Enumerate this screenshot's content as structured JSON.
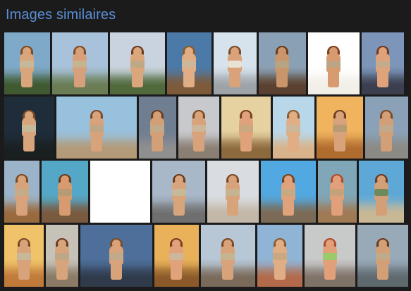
{
  "page": {
    "title": "Images similaires",
    "accent_color": "#5b8fd6",
    "background_color": "#1b1b1b"
  },
  "rows": [
    [
      {
        "sky": "#7fa9c8",
        "ground": "#3f5a30",
        "skin": "#d9a57a",
        "hair": "#7a4a24",
        "outfit": "#c8b89a"
      },
      {
        "sky": "#a7c2da",
        "ground": "#6a7d55",
        "skin": "#d7a07a",
        "hair": "#7a4a24",
        "outfit": "#c6b491"
      },
      {
        "sky": "#c9d3df",
        "ground": "#516a3b",
        "skin": "#dca67d",
        "hair": "#6b3a1e",
        "outfit": "#bfa886"
      },
      {
        "sky": "#4c7aa8",
        "ground": "#7d5a3a",
        "skin": "#e1ad84",
        "hair": "#8a5a2b",
        "outfit": "#cdb79a"
      },
      {
        "sky": "#d6e2ec",
        "ground": "#9ea3a8",
        "skin": "#d8a27a",
        "hair": "#7a4a24",
        "outfit": "#e8e2d4"
      },
      {
        "sky": "#8aa1b5",
        "ground": "#5b4230",
        "skin": "#c9956b",
        "hair": "#6b3a1e",
        "outfit": "#b7a481"
      },
      {
        "sky": "#ffffff",
        "ground": "#f2efe8",
        "skin": "#d89a6f",
        "hair": "#7a3e1e",
        "outfit": "#bca586"
      },
      {
        "sky": "#7c95b8",
        "ground": "#3b3f4f",
        "skin": "#e0a27b",
        "hair": "#6f3a20",
        "outfit": "#c5aa8b"
      }
    ],
    [
      {
        "sky": "#1f2d3a",
        "ground": "#1a2022",
        "skin": "#d7a47c",
        "hair": "#7a4a24",
        "outfit": "#c8b89a"
      },
      {
        "sky": "#98c1de",
        "ground": "#b39a78",
        "skin": "#d8a27a",
        "hair": "#7a4a24",
        "outfit": "#bea686"
      },
      {
        "sky": "#6f7e90",
        "ground": "#8f8f8f",
        "skin": "#d39f77",
        "hair": "#6b3a1e",
        "outfit": "#c0aa8b"
      },
      {
        "sky": "#c7c9cc",
        "ground": "#8b7e73",
        "skin": "#d8a27a",
        "hair": "#7a4a24",
        "outfit": "#cdb79a"
      },
      {
        "sky": "#e6d1a0",
        "ground": "#8c6a3d",
        "skin": "#e0a27b",
        "hair": "#7a3e1e",
        "outfit": "#c9a982"
      },
      {
        "sky": "#b8d8ea",
        "ground": "#d9b38b",
        "skin": "#e1ad84",
        "hair": "#8a5a2b",
        "outfit": "#cdb79a"
      },
      {
        "sky": "#f0b35e",
        "ground": "#b06b2e",
        "skin": "#d8a27a",
        "hair": "#6b3a1e",
        "outfit": "#b79b74"
      },
      {
        "sky": "#8ba1b7",
        "ground": "#8c8a84",
        "skin": "#d39f77",
        "hair": "#7a4a24",
        "outfit": "#c0aa8b"
      }
    ],
    [
      {
        "sky": "#9bb4c9",
        "ground": "#9a6a3f",
        "skin": "#d8a27a",
        "hair": "#7a4a24",
        "outfit": "#c5ab88"
      },
      {
        "sky": "#55a7c7",
        "ground": "#7a5a3f",
        "skin": "#d89a6f",
        "hair": "#6b3a1e",
        "outfit": "#b79b74"
      },
      {
        "sky": "#ffffff",
        "ground": "#ffffff",
        "skin": "#ffffff",
        "hair": "#ffffff",
        "outfit": "#ffffff"
      },
      {
        "sky": "#a8b8c8",
        "ground": "#6f6f6f",
        "skin": "#d7a47c",
        "hair": "#6b3a1e",
        "outfit": "#c8b89a"
      },
      {
        "sky": "#d9dde2",
        "ground": "#c3b8a8",
        "skin": "#d8a27a",
        "hair": "#7a4a24",
        "outfit": "#c6b491"
      },
      {
        "sky": "#52a8e0",
        "ground": "#7b6a55",
        "skin": "#e0a27b",
        "hair": "#7a3e1e",
        "outfit": "#c9a982"
      },
      {
        "sky": "#7fa7b8",
        "ground": "#a07a55",
        "skin": "#e1a07a",
        "hair": "#b04a2a",
        "outfit": "#c5a27a"
      },
      {
        "sky": "#5ea8d8",
        "ground": "#c8b896",
        "skin": "#d39f77",
        "hair": "#6b3a1e",
        "outfit": "#6f8a5a"
      },
      {
        "sky": "#b56a3a",
        "ground": "#3a2a20",
        "skin": "#e1ad84",
        "hair": "#8a5a2b",
        "outfit": "#c9a982"
      }
    ],
    [
      {
        "sky": "#f0c36a",
        "ground": "#c07a3a",
        "skin": "#d8a27a",
        "hair": "#7a4a24",
        "outfit": "#c8b89a"
      },
      {
        "sky": "#c7c2b7",
        "ground": "#8a7a66",
        "skin": "#d7a47c",
        "hair": "#6b3a1e",
        "outfit": "#bea686"
      },
      {
        "sky": "#4d6f9a",
        "ground": "#2f3a4a",
        "skin": "#d8a27a",
        "hair": "#7a4a24",
        "outfit": "#c0aa8b"
      },
      {
        "sky": "#e9b25a",
        "ground": "#8c5a2a",
        "skin": "#e0a27b",
        "hair": "#7a3e1e",
        "outfit": "#cdb79a"
      },
      {
        "sky": "#b7c7d6",
        "ground": "#7a6a5a",
        "skin": "#d8a27a",
        "hair": "#7a4a24",
        "outfit": "#c6b491"
      },
      {
        "sky": "#8fb4d6",
        "ground": "#b26a4a",
        "skin": "#e1ad84",
        "hair": "#8a5a2b",
        "outfit": "#c9a982"
      },
      {
        "sky": "#c8c9c9",
        "ground": "#7f7368",
        "skin": "#e1a07a",
        "hair": "#b04a2a",
        "outfit": "#9acb6a"
      },
      {
        "sky": "#98a9b8",
        "ground": "#5f6a6f",
        "skin": "#d39f77",
        "hair": "#6b3a1e",
        "outfit": "#c0aa8b"
      }
    ]
  ]
}
